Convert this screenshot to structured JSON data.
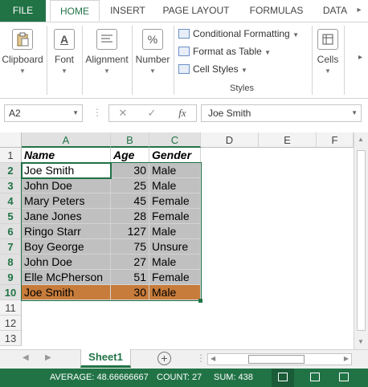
{
  "ribbon_tabs": [
    "FILE",
    "HOME",
    "INSERT",
    "PAGE LAYOUT",
    "FORMULAS",
    "DATA"
  ],
  "ribbon_groups": {
    "clipboard": "Clipboard",
    "font": "Font",
    "alignment": "Alignment",
    "number": "Number",
    "cells": "Cells",
    "number_icon": "%",
    "font_icon": "A",
    "styles_items": [
      "Conditional Formatting",
      "Format as Table",
      "Cell Styles"
    ],
    "styles_label": "Styles"
  },
  "formula_bar": {
    "name_box": "A2",
    "fx": "fx",
    "cancel": "✕",
    "confirm": "✓",
    "content": "Joe Smith"
  },
  "columns": [
    "A",
    "B",
    "C",
    "D",
    "E",
    "F"
  ],
  "rows": [
    "1",
    "2",
    "3",
    "4",
    "5",
    "6",
    "7",
    "8",
    "9",
    "10",
    "11",
    "12",
    "13"
  ],
  "table": {
    "header": [
      "Name",
      "Age",
      "Gender"
    ],
    "rows": [
      [
        "Joe Smith",
        "30",
        "Male"
      ],
      [
        "John Doe",
        "25",
        "Male"
      ],
      [
        "Mary Peters",
        "45",
        "Female"
      ],
      [
        "Jane Jones",
        "28",
        "Female"
      ],
      [
        "Ringo Starr",
        "127",
        "Male"
      ],
      [
        "Boy George",
        "75",
        "Unsure"
      ],
      [
        "John Doe",
        "27",
        "Male"
      ],
      [
        "Elle McPherson",
        "51",
        "Female"
      ],
      [
        "Joe Smith",
        "30",
        "Male"
      ]
    ]
  },
  "sheet_tab": "Sheet1",
  "status": {
    "average": "AVERAGE: 48.66666667",
    "count": "COUNT: 27",
    "sum": "SUM: 438"
  },
  "colors": {
    "accent": "#217346",
    "selection_fill": "#c0c0c0",
    "highlight_row": "#c77c3b"
  }
}
